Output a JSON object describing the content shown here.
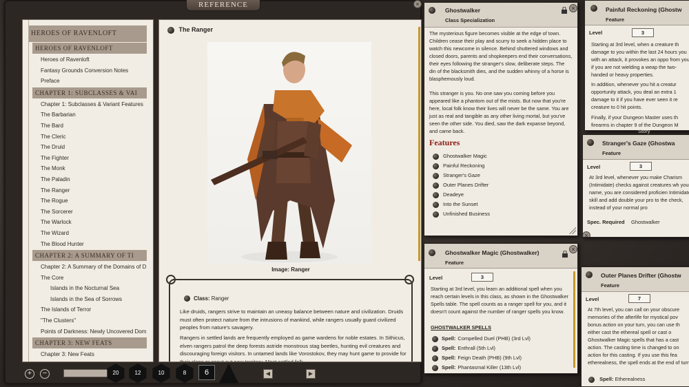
{
  "reference_window": {
    "tab_label": "REFERENCE",
    "toc": {
      "top_header": "HEROES OF RAVENLOFT",
      "sections": [
        {
          "header": "HEROES OF RAVENLOFT",
          "items": [
            {
              "label": "Heroes of Ravenloft",
              "level": 1
            },
            {
              "label": "Fantasy Grounds Conversion Notes",
              "level": 1
            },
            {
              "label": "Preface",
              "level": 1
            }
          ]
        },
        {
          "header": "CHAPTER 1: SUBCLASSES & VAI",
          "items": [
            {
              "label": "Chapter 1: Subclasses & Variant Features",
              "level": 1
            },
            {
              "label": "The Barbarian",
              "level": 1
            },
            {
              "label": "The Bard",
              "level": 1
            },
            {
              "label": "The Cleric",
              "level": 1
            },
            {
              "label": "The Druid",
              "level": 1
            },
            {
              "label": "The Fighter",
              "level": 1
            },
            {
              "label": "The Monk",
              "level": 1
            },
            {
              "label": "The Paladin",
              "level": 1
            },
            {
              "label": "The Ranger",
              "level": 1
            },
            {
              "label": "The Rogue",
              "level": 1
            },
            {
              "label": "The Sorcerer",
              "level": 1
            },
            {
              "label": "The Warlock",
              "level": 1
            },
            {
              "label": "The Wizard",
              "level": 1
            },
            {
              "label": "The Blood Hunter",
              "level": 1
            }
          ]
        },
        {
          "header": "CHAPTER 2: A SUMMARY OF TI",
          "items": [
            {
              "label": "Chapter 2: A Summary of the Domains of D",
              "level": 1
            },
            {
              "label": "The Core",
              "level": 1
            },
            {
              "label": "Islands in the Nocturnal Sea",
              "level": 2
            },
            {
              "label": "Islands in the Sea of Sorrows",
              "level": 2
            },
            {
              "label": "The Islands of Terror",
              "level": 1
            },
            {
              "label": "\"The Clusters\"",
              "level": 1
            },
            {
              "label": "Points of Darkness: Newly Uncovered Dom",
              "level": 1
            }
          ]
        },
        {
          "header": "CHAPTER 3: NEW FEATS",
          "items": [
            {
              "label": "Chapter 3: New Feats",
              "level": 1
            }
          ]
        }
      ]
    },
    "content": {
      "title": "The Ranger",
      "image_caption": "Image: Ranger",
      "class_label": "Class:",
      "class_value": "Ranger",
      "para1": "Like druids, rangers strive to maintain an uneasy balance between nature and civilization. Druids must often protect nature from the intrusions of mankind, while rangers usually guard civilized peoples from nature's savagery.",
      "para2": "Rangers in settled lands are frequently employed as game wardens for noble estates. In Sithicus, elven rangers patrol the deep forests astride monstrous stag beetles, hunting evil creatures and discouraging foreign visitors. In untamed lands like Vorostokov, they may hunt game to provide for their clans or scout out new territory. Most settled folk"
    },
    "toolbar": {
      "dice": [
        "20",
        "12",
        "10",
        "8"
      ],
      "modifier": "6",
      "prev_icon": "◀",
      "next_icon": "▶"
    }
  },
  "ghostwalker_card": {
    "title": "Ghostwalker",
    "subtitle": "Class Specialization",
    "para1": "The mysterious figure becomes visible at the edge of town. Children cease their play and scurry to seek a hidden place to watch this newcome in silence. Behind shuttered windows and closed doors, parents and shopkeepers end their conversations, their eyes following the stranger's slow, deliberate steps. The din of the blacksmith dies, and the sudden whinny of a horse is blasphemously loud.",
    "para2": "This stranger is you. No one saw you coming before you appeared like a phantom out of the mists. But now that you're here, local folk know their lives will never be the same. You are just as real and tangible as any other living mortal, but you've seen the other side. You died, saw the dark expanse beyond, and came back.",
    "features_title": "Features",
    "features": [
      "Ghostwalker Magic",
      "Painful Reckoning",
      "Stranger's Gaze",
      "Outer Planes Drifter",
      "Deadeye",
      "Into the Sunset",
      "Unfinished Business"
    ]
  },
  "painful_card": {
    "title": "Painful Reckoning (Ghostw",
    "subtitle": "Feature",
    "level_label": "Level",
    "level": "3",
    "para1": "Starting at 3rd level, when a creature th damage to you within the last 24 hours you with an attack, it provokes an oppo from you if you are not wielding a weap the two-handed or heavy properties.",
    "para2": "In addition, whenever you hit a creatur opportunity attack, you deal an extra 1 damage to it if you have ever seen it re creature to 0 hit points.",
    "para3": "Finally, if your Dungeon Master uses th firearms in chapter 9 of the Dungeon M",
    "tab_label": "Story"
  },
  "stranger_card": {
    "title": "Stranger's Gaze (Ghostwa",
    "subtitle": "Feature",
    "level_label": "Level",
    "level": "3",
    "para1": "At 3rd level, whenever you make Charism (Intimidate) checks against creatures wh your name, you are considered proficien Intimidate skill and add double your pro to the check, instead of your normal pro",
    "spec_label": "Spec. Required",
    "spec_value": "Ghostwalker"
  },
  "magic_card": {
    "title": "Ghostwalker Magic (Ghostwalker)",
    "subtitle": "Feature",
    "level_label": "Level",
    "level": "3",
    "para1": "Starting at 3rd level, you learn an additional spell when you reach certain levels in this class, as shown in the Ghostwalker Spells table. The spell counts as a ranger spell for you, and it doesn't count against the number of ranger spells you know.",
    "spells_header": "GHOSTWALKER SPELLS",
    "spell_label": "Spell:",
    "spells": [
      "Compelled Duel (PHB) (3rd Lvl)",
      "Enthrall (5th Lvl)",
      "Feign Death (PHB) (9th Lvl)",
      "Phantasmal Killer (13th Lvl)"
    ]
  },
  "drifter_card": {
    "title": "Outer Planes Drifter (Ghostw",
    "subtitle": "Feature",
    "level_label": "Level",
    "level": "7",
    "para1": "At 7th level, you can call on your obscure memories of the afterlife for mystical pov bonus action on your turn, you can use th either cast the ethereal spell or cast o Ghostwalker Magic spells that has a cast action. The casting time is changed to on action for this casting. If you use this fea etherealness, the spell ends at the end of turn.",
    "spell_label": "Spell:",
    "spell_value": "Etherealness"
  }
}
